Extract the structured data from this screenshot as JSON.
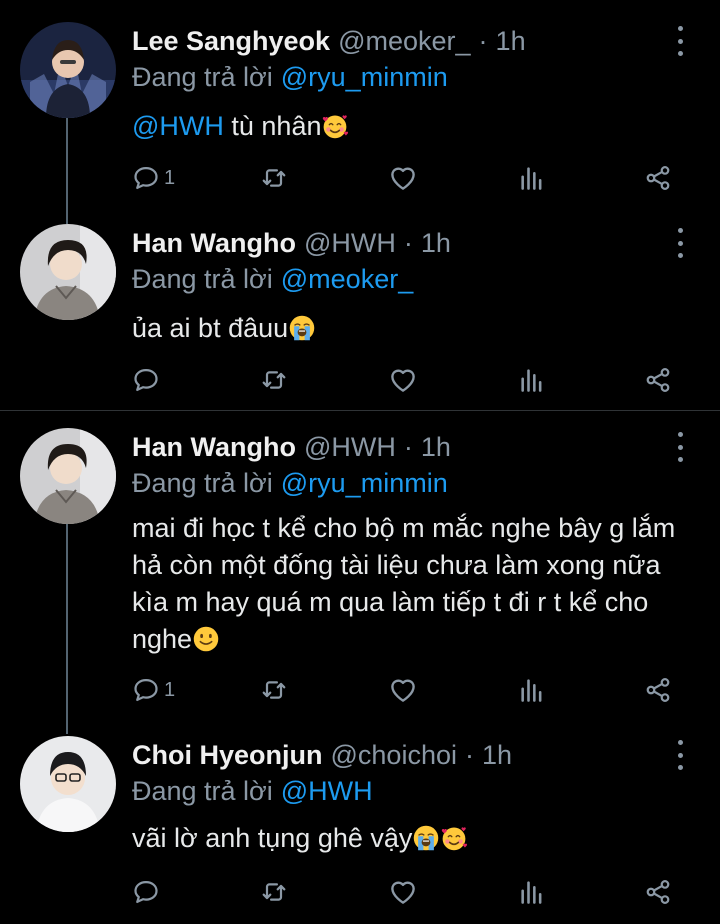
{
  "tweets": [
    {
      "name": "Lee Sanghyeok",
      "handle": "@meoker_",
      "time": "1h",
      "replying_prefix": "Đang trả lời",
      "replying_to": "@ryu_minmin",
      "mention": "@HWH",
      "text": " tù nhân",
      "emoji": "smiling-face-with-hearts",
      "reply_count": "1"
    },
    {
      "name": "Han Wangho",
      "handle": "@HWH",
      "time": "1h",
      "replying_prefix": "Đang trả lời",
      "replying_to": "@meoker_",
      "text": "ủa ai bt đâuu",
      "emoji": "loudly-crying-face",
      "reply_count": ""
    },
    {
      "name": "Han Wangho",
      "handle": "@HWH",
      "time": "1h",
      "replying_prefix": "Đang trả lời",
      "replying_to": "@ryu_minmin",
      "text": "mai đi học t kể cho bộ m mắc nghe bây g lắm hả còn một đống tài liệu chưa làm xong nữa kìa m hay quá m qua làm tiếp t đi r t kể cho nghe",
      "emoji": "slightly-smiling-face",
      "reply_count": "1"
    },
    {
      "name": "Choi Hyeonjun",
      "handle": "@choichoi",
      "time": "1h",
      "replying_prefix": "Đang trả lời",
      "replying_to": "@HWH",
      "text": "vãi lờ anh tụng ghê vậy",
      "emoji": "loudly-crying-face + smiling-face-with-hearts",
      "reply_count": ""
    }
  ],
  "separator": "·",
  "colors": {
    "background": "#000000",
    "text": "#e7e9ea",
    "secondary": "#8b98a5",
    "link": "#1d9bf0",
    "thread_line": "#536471"
  }
}
